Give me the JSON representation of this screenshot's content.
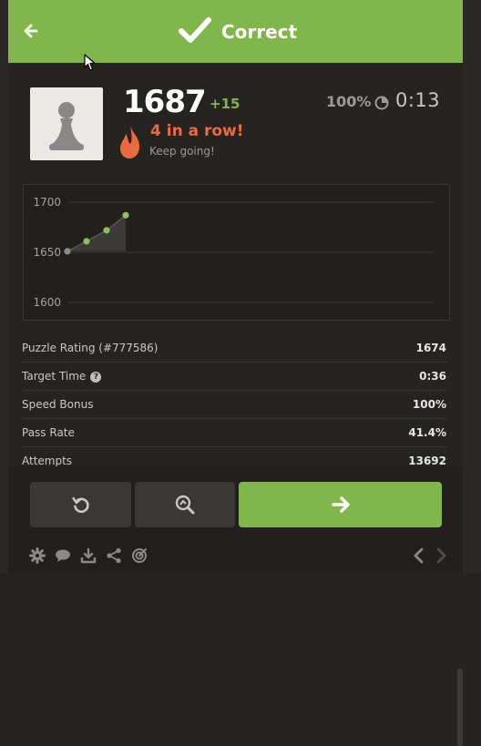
{
  "header": {
    "status_label": "Correct",
    "accent_color": "#81b64c"
  },
  "player": {
    "avatar_icon": "pawn-icon",
    "rating": "1687",
    "rating_delta": "+15",
    "streak_text": "4 in a row!",
    "streak_sub": "Keep going!",
    "accuracy": "100%",
    "timer": "0:13"
  },
  "chart_data": {
    "type": "area",
    "x": [
      1,
      2,
      3,
      4
    ],
    "y": [
      1651,
      1661,
      1672,
      1687
    ],
    "ylim": [
      1590,
      1710
    ],
    "yticks": [
      1600,
      1650,
      1700
    ],
    "title": "",
    "xlabel": "",
    "ylabel": "",
    "grid": true
  },
  "stats": [
    {
      "label": "Puzzle Rating (#777586)",
      "value": "1674"
    },
    {
      "label": "Target Time",
      "value": "0:36",
      "help": true
    },
    {
      "label": "Speed Bonus",
      "value": "100%"
    },
    {
      "label": "Pass Rate",
      "value": "41.4%"
    },
    {
      "label": "Attempts",
      "value": "13692"
    }
  ],
  "footer": {
    "icons": [
      "gear-icon",
      "chat-icon",
      "download-icon",
      "share-icon",
      "target-icon"
    ]
  }
}
